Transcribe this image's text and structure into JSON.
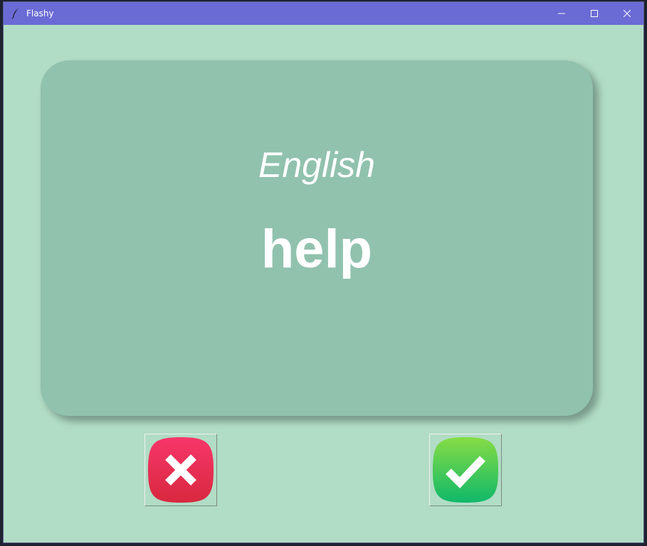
{
  "window": {
    "title": "Flashy",
    "app_icon": "feather-icon",
    "controls": [
      "minimize-icon",
      "maximize-icon",
      "close-icon"
    ],
    "titlebar_color": "#6b6bd6",
    "background_color": "#b1dcc5"
  },
  "card": {
    "language": "English",
    "word": "help",
    "color": "#91c2ae"
  },
  "buttons": {
    "wrong": {
      "icon": "cross-icon",
      "color": "#e8325a"
    },
    "right": {
      "icon": "checkmark-icon",
      "color": "#2ec85a"
    }
  }
}
